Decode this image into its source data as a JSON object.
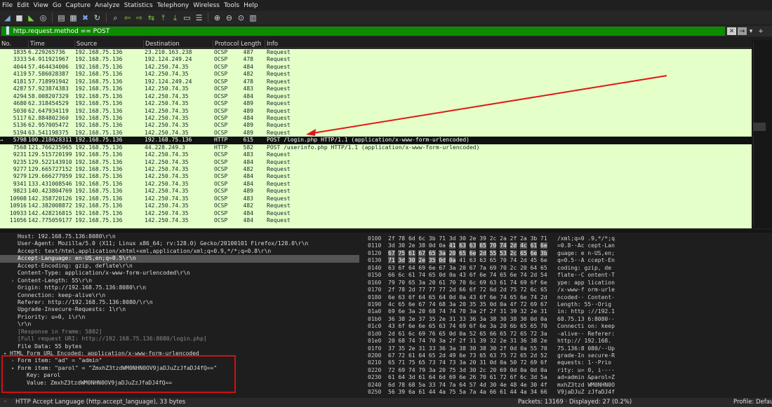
{
  "menu": [
    "File",
    "Edit",
    "View",
    "Go",
    "Capture",
    "Analyze",
    "Statistics",
    "Telephony",
    "Wireless",
    "Tools",
    "Help"
  ],
  "toolbar_icons": [
    {
      "name": "shark-fin-start-icon",
      "glyph": "◢",
      "cls": "b"
    },
    {
      "name": "stop-capture-icon",
      "glyph": "■",
      "cls": ""
    },
    {
      "name": "restart-capture-icon",
      "glyph": "◣",
      "cls": "g"
    },
    {
      "name": "capture-options-icon",
      "glyph": "◎",
      "cls": ""
    },
    {
      "sep": true
    },
    {
      "name": "open-file-icon",
      "glyph": "▤",
      "cls": ""
    },
    {
      "name": "save-file-icon",
      "glyph": "▦",
      "cls": ""
    },
    {
      "name": "close-file-icon",
      "glyph": "✖",
      "cls": "b"
    },
    {
      "name": "reload-file-icon",
      "glyph": "↻",
      "cls": ""
    },
    {
      "sep": true
    },
    {
      "name": "find-packet-icon",
      "glyph": "⌕",
      "cls": ""
    },
    {
      "name": "go-back-icon",
      "glyph": "⇦",
      "cls": "g"
    },
    {
      "name": "go-forward-icon",
      "glyph": "⇨",
      "cls": "g"
    },
    {
      "name": "go-to-packet-icon",
      "glyph": "⇆",
      "cls": "g"
    },
    {
      "name": "first-packet-icon",
      "glyph": "⤒",
      "cls": "g"
    },
    {
      "name": "last-packet-icon",
      "glyph": "⤓",
      "cls": "g"
    },
    {
      "name": "autoscroll-icon",
      "glyph": "▭",
      "cls": ""
    },
    {
      "name": "colorize-icon",
      "glyph": "☰",
      "cls": ""
    },
    {
      "sep": true
    },
    {
      "name": "zoom-in-icon",
      "glyph": "⊕",
      "cls": ""
    },
    {
      "name": "zoom-out-icon",
      "glyph": "⊖",
      "cls": ""
    },
    {
      "name": "zoom-normal-icon",
      "glyph": "⊙",
      "cls": ""
    },
    {
      "name": "resize-columns-icon",
      "glyph": "▥",
      "cls": ""
    }
  ],
  "filter": {
    "value": "http.request.method == POST"
  },
  "columns": [
    "No.",
    "Time",
    "Source",
    "Destination",
    "Protocol",
    "Length",
    "Info"
  ],
  "packets": [
    [
      "1835",
      "6.229265736",
      "192.168.75.136",
      "23.210.163.238",
      "OCSP",
      "487",
      "Request"
    ],
    [
      "3333",
      "54.911921967",
      "192.168.75.136",
      "192.124.249.24",
      "OCSP",
      "478",
      "Request"
    ],
    [
      "4044",
      "57.464434006",
      "192.168.75.136",
      "142.250.74.35",
      "OCSP",
      "484",
      "Request"
    ],
    [
      "4119",
      "57.586028387",
      "192.168.75.136",
      "142.250.74.35",
      "OCSP",
      "482",
      "Request"
    ],
    [
      "4181",
      "57.718991942",
      "192.168.75.136",
      "192.124.249.24",
      "OCSP",
      "478",
      "Request"
    ],
    [
      "4287",
      "57.923874383",
      "192.168.75.136",
      "142.250.74.35",
      "OCSP",
      "483",
      "Request"
    ],
    [
      "4294",
      "58.008207329",
      "192.168.75.136",
      "142.250.74.35",
      "OCSP",
      "484",
      "Request"
    ],
    [
      "4680",
      "62.318454529",
      "192.168.75.136",
      "142.250.74.35",
      "OCSP",
      "489",
      "Request"
    ],
    [
      "5030",
      "62.647934119",
      "192.168.75.136",
      "142.250.74.35",
      "OCSP",
      "489",
      "Request"
    ],
    [
      "5117",
      "62.884802360",
      "192.168.75.136",
      "142.250.74.35",
      "OCSP",
      "484",
      "Request"
    ],
    [
      "5136",
      "62.957005472",
      "192.168.75.136",
      "142.250.74.35",
      "OCSP",
      "489",
      "Request"
    ],
    [
      "5194",
      "63.541198375",
      "192.168.75.136",
      "142.250.74.35",
      "OCSP",
      "489",
      "Request"
    ],
    [
      "5798",
      "100.218628311",
      "192.168.75.136",
      "192.168.75.136",
      "HTTP",
      "615",
      "POST /login.php HTTP/1.1  (application/x-www-form-urlencoded)"
    ],
    [
      "7568",
      "121.766235965",
      "192.168.75.136",
      "44.228.249.3",
      "HTTP",
      "582",
      "POST /userinfo.php HTTP/1.1  (application/x-www-form-urlencoded)"
    ],
    [
      "9231",
      "129.515720199",
      "192.168.75.136",
      "142.250.74.35",
      "OCSP",
      "483",
      "Request"
    ],
    [
      "9235",
      "129.522143910",
      "192.168.75.136",
      "142.250.74.35",
      "OCSP",
      "484",
      "Request"
    ],
    [
      "9277",
      "129.665727152",
      "192.168.75.136",
      "142.250.74.35",
      "OCSP",
      "482",
      "Request"
    ],
    [
      "9279",
      "129.666277959",
      "192.168.75.136",
      "142.250.74.35",
      "OCSP",
      "484",
      "Request"
    ],
    [
      "9341",
      "133.431008546",
      "192.168.75.136",
      "142.250.74.35",
      "OCSP",
      "484",
      "Request"
    ],
    [
      "9823",
      "140.423804769",
      "192.168.75.136",
      "142.250.74.35",
      "OCSP",
      "489",
      "Request"
    ],
    [
      "10908",
      "142.358720126",
      "192.168.75.136",
      "142.250.74.35",
      "OCSP",
      "483",
      "Request"
    ],
    [
      "10916",
      "142.382008872",
      "192.168.75.136",
      "142.250.74.35",
      "OCSP",
      "482",
      "Request"
    ],
    [
      "10933",
      "142.428216815",
      "192.168.75.136",
      "142.250.74.35",
      "OCSP",
      "484",
      "Request"
    ],
    [
      "11056",
      "142.775059177",
      "192.168.75.136",
      "142.250.74.35",
      "OCSP",
      "484",
      "Request"
    ]
  ],
  "selected_packet": "5798",
  "details": [
    {
      "text": "Host: 192.168.75.136:8080\\r\\n",
      "indent": 1
    },
    {
      "text": "User-Agent: Mozilla/5.0 (X11; Linux x86_64; rv:128.0) Gecko/20100101 Firefox/128.0\\r\\n",
      "indent": 1
    },
    {
      "text": "Accept: text/html,application/xhtml+xml,application/xml;q=0.9,*/*;q=0.8\\r\\n",
      "indent": 1
    },
    {
      "text": "Accept-Language: en-US,en;q=0.5\\r\\n",
      "indent": 1,
      "hl": true
    },
    {
      "text": "Accept-Encoding: gzip, deflate\\r\\n",
      "indent": 1
    },
    {
      "text": "Content-Type: application/x-www-form-urlencoded\\r\\n",
      "indent": 1
    },
    {
      "text": "Content-Length: 55\\r\\n",
      "indent": 1,
      "tw": "›"
    },
    {
      "text": "Origin: http://192.168.75.136:8080\\r\\n",
      "indent": 1
    },
    {
      "text": "Connection: keep-alive\\r\\n",
      "indent": 1
    },
    {
      "text": "Referer: http://192.168.75.136:8080/\\r\\n",
      "indent": 1
    },
    {
      "text": "Upgrade-Insecure-Requests: 1\\r\\n",
      "indent": 1
    },
    {
      "text": "Priority: u=0, i\\r\\n",
      "indent": 1
    },
    {
      "text": "\\r\\n",
      "indent": 1
    },
    {
      "text": "[Response in frame: 5802]",
      "indent": 1,
      "lnk": true
    },
    {
      "text": "[Full request URI: http://192.168.75.136:8080/login.php]",
      "indent": 1,
      "lnk": true
    },
    {
      "text": "File Data: 55 bytes",
      "indent": 1
    },
    {
      "text": "HTML Form URL Encoded: application/x-www-form-urlencoded",
      "indent": 0,
      "tw": "▾"
    },
    {
      "text": "Form item: \"ad\" = \"admin\"",
      "indent": 1,
      "tw": "›"
    },
    {
      "text": "Form item: \"parol\" = \"ZmxhZ3tzdWM0NHN0OV9jaDJuZzJfaDJ4fQ==\"",
      "indent": 1,
      "tw": "▾"
    },
    {
      "text": "Key: parol",
      "indent": 2
    },
    {
      "text": "Value: ZmxhZ3tzdWM0NHN0OV9jaDJuZzJfaDJ4fQ==",
      "indent": 2
    }
  ],
  "hex_rows": [
    {
      "off": "0100",
      "hex": [
        "2f",
        "78",
        "6d",
        "6c",
        "3b",
        "71",
        "3d",
        "30",
        "2e",
        "39",
        "2c",
        "2a",
        "2f",
        "2a",
        "3b",
        "71"
      ],
      "asc": "/xml;q=0 .9,*/*;q",
      "hi": []
    },
    {
      "off": "0110",
      "hex": [
        "3d",
        "30",
        "2e",
        "38",
        "0d",
        "0a",
        "41",
        "63",
        "63",
        "65",
        "70",
        "74",
        "2d",
        "4c",
        "61",
        "6e"
      ],
      "asc": "=0.8··Ac cept-Lan",
      "hi": [
        6,
        7,
        8,
        9,
        10,
        11,
        12,
        13,
        14,
        15
      ]
    },
    {
      "off": "0120",
      "hex": [
        "67",
        "75",
        "61",
        "67",
        "65",
        "3a",
        "20",
        "65",
        "6e",
        "2d",
        "55",
        "53",
        "2c",
        "65",
        "6e",
        "3b"
      ],
      "asc": "guage: e n-US,en;",
      "hi": [
        0,
        1,
        2,
        3,
        4,
        5,
        6,
        7,
        8,
        9,
        10,
        11,
        12,
        13,
        14,
        15
      ]
    },
    {
      "off": "0130",
      "hex": [
        "71",
        "3d",
        "30",
        "2e",
        "35",
        "0d",
        "0a",
        "41",
        "63",
        "63",
        "65",
        "70",
        "74",
        "2d",
        "45",
        "6e"
      ],
      "asc": "q=0.5··A ccept-En",
      "hi": [
        0,
        1,
        2,
        3,
        4,
        5,
        6
      ]
    },
    {
      "off": "0140",
      "hex": [
        "63",
        "6f",
        "64",
        "69",
        "6e",
        "67",
        "3a",
        "20",
        "67",
        "7a",
        "69",
        "70",
        "2c",
        "20",
        "64",
        "65"
      ],
      "asc": "coding:  gzip, de",
      "hi": []
    },
    {
      "off": "0150",
      "hex": [
        "66",
        "6c",
        "61",
        "74",
        "65",
        "0d",
        "0a",
        "43",
        "6f",
        "6e",
        "74",
        "65",
        "6e",
        "74",
        "2d",
        "54"
      ],
      "asc": "flate··C ontent-T",
      "hi": []
    },
    {
      "off": "0160",
      "hex": [
        "79",
        "70",
        "65",
        "3a",
        "20",
        "61",
        "70",
        "70",
        "6c",
        "69",
        "63",
        "61",
        "74",
        "69",
        "6f",
        "6e"
      ],
      "asc": "ype: app lication",
      "hi": []
    },
    {
      "off": "0170",
      "hex": [
        "2f",
        "78",
        "2d",
        "77",
        "77",
        "77",
        "2d",
        "66",
        "6f",
        "72",
        "6d",
        "2d",
        "75",
        "72",
        "6c",
        "65"
      ],
      "asc": "/x-www-f orm-urle",
      "hi": []
    },
    {
      "off": "0180",
      "hex": [
        "6e",
        "63",
        "6f",
        "64",
        "65",
        "64",
        "0d",
        "0a",
        "43",
        "6f",
        "6e",
        "74",
        "65",
        "6e",
        "74",
        "2d"
      ],
      "asc": "ncoded·· Content-",
      "hi": []
    },
    {
      "off": "0190",
      "hex": [
        "4c",
        "65",
        "6e",
        "67",
        "74",
        "68",
        "3a",
        "20",
        "35",
        "35",
        "0d",
        "0a",
        "4f",
        "72",
        "69",
        "67"
      ],
      "asc": "Length:  55··Orig",
      "hi": []
    },
    {
      "off": "01a0",
      "hex": [
        "69",
        "6e",
        "3a",
        "20",
        "68",
        "74",
        "74",
        "70",
        "3a",
        "2f",
        "2f",
        "31",
        "39",
        "32",
        "2e",
        "31"
      ],
      "asc": "in: http ://192.1",
      "hi": []
    },
    {
      "off": "01b0",
      "hex": [
        "36",
        "38",
        "2e",
        "37",
        "35",
        "2e",
        "31",
        "33",
        "36",
        "3a",
        "38",
        "30",
        "38",
        "30",
        "0d",
        "0a"
      ],
      "asc": "68.75.13 6:8080··",
      "hi": []
    },
    {
      "off": "01c0",
      "hex": [
        "43",
        "6f",
        "6e",
        "6e",
        "65",
        "63",
        "74",
        "69",
        "6f",
        "6e",
        "3a",
        "20",
        "6b",
        "65",
        "65",
        "70"
      ],
      "asc": "Connecti on: keep",
      "hi": []
    },
    {
      "off": "01d0",
      "hex": [
        "2d",
        "61",
        "6c",
        "69",
        "76",
        "65",
        "0d",
        "0a",
        "52",
        "65",
        "66",
        "65",
        "72",
        "65",
        "72",
        "3a"
      ],
      "asc": "-alive·· Referer:",
      "hi": []
    },
    {
      "off": "01e0",
      "hex": [
        "20",
        "68",
        "74",
        "74",
        "70",
        "3a",
        "2f",
        "2f",
        "31",
        "39",
        "32",
        "2e",
        "31",
        "36",
        "38",
        "2e"
      ],
      "asc": " http:// 192.168.",
      "hi": []
    },
    {
      "off": "01f0",
      "hex": [
        "37",
        "35",
        "2e",
        "31",
        "33",
        "36",
        "3a",
        "38",
        "30",
        "38",
        "30",
        "2f",
        "0d",
        "0a",
        "55",
        "70"
      ],
      "asc": "75.136:8 080/··Up",
      "hi": []
    },
    {
      "off": "0200",
      "hex": [
        "67",
        "72",
        "61",
        "64",
        "65",
        "2d",
        "49",
        "6e",
        "73",
        "65",
        "63",
        "75",
        "72",
        "65",
        "2d",
        "52"
      ],
      "asc": "grade-In secure-R",
      "hi": []
    },
    {
      "off": "0210",
      "hex": [
        "65",
        "71",
        "75",
        "65",
        "73",
        "74",
        "73",
        "3a",
        "20",
        "31",
        "0d",
        "0a",
        "50",
        "72",
        "69",
        "6f"
      ],
      "asc": "equests:  1··Prio",
      "hi": []
    },
    {
      "off": "0220",
      "hex": [
        "72",
        "69",
        "74",
        "79",
        "3a",
        "20",
        "75",
        "3d",
        "30",
        "2c",
        "20",
        "69",
        "0d",
        "0a",
        "0d",
        "0a"
      ],
      "asc": "rity: u= 0, i····",
      "hi": []
    },
    {
      "off": "0230",
      "hex": [
        "61",
        "64",
        "3d",
        "61",
        "64",
        "6d",
        "69",
        "6e",
        "26",
        "70",
        "61",
        "72",
        "6f",
        "6c",
        "3d",
        "5a"
      ],
      "asc": "ad=admin &parol=Z",
      "hi": []
    },
    {
      "off": "0240",
      "hex": [
        "6d",
        "78",
        "68",
        "5a",
        "33",
        "74",
        "7a",
        "64",
        "57",
        "4d",
        "30",
        "4e",
        "48",
        "4e",
        "30",
        "4f"
      ],
      "asc": "mxhZ3tzd WM0NHN0O",
      "hi": []
    },
    {
      "off": "0250",
      "hex": [
        "56",
        "39",
        "6a",
        "61",
        "44",
        "4a",
        "75",
        "5a",
        "7a",
        "4a",
        "66",
        "61",
        "44",
        "4a",
        "34",
        "66"
      ],
      "asc": "V9jaDJuZ zJfaDJ4f",
      "hi": []
    },
    {
      "off": "0260",
      "hex": [
        "51",
        "25",
        "33",
        "44",
        "25",
        "33",
        "44"
      ],
      "asc": "Q%3D%3D",
      "hi": []
    }
  ],
  "status": {
    "left": "HTTP Accept Language (http.accept_language), 33 bytes",
    "packets": "Packets: 13169 · Displayed: 27 (0.2%)",
    "profile": "Profile: Default"
  }
}
